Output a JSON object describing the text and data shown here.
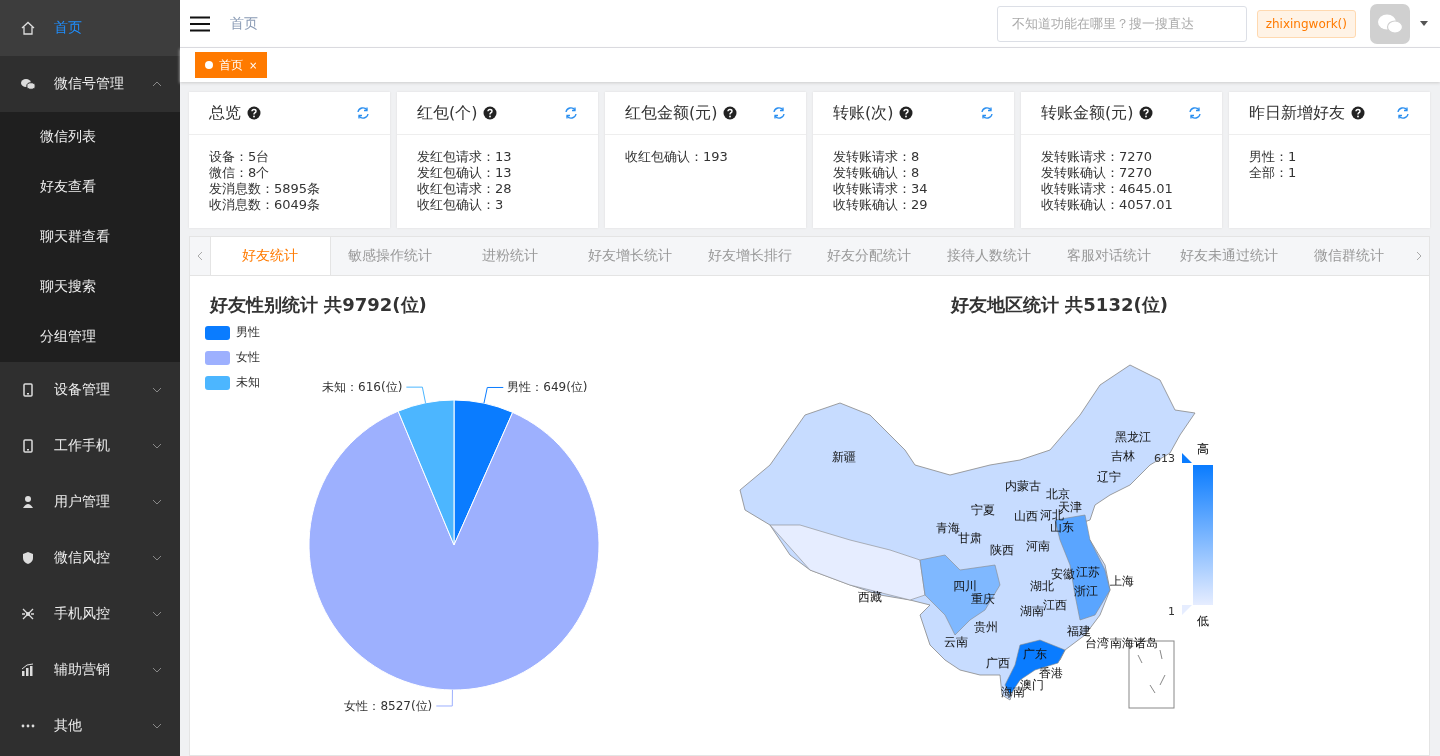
{
  "sidebar": {
    "items": [
      {
        "label": "首页",
        "selected": true,
        "expanded": false
      },
      {
        "label": "微信号管理",
        "selected": false,
        "expanded": true,
        "children": [
          {
            "label": "微信列表",
            "selected": false
          },
          {
            "label": "好友查看",
            "selected": false
          },
          {
            "label": "聊天群查看",
            "selected": false
          },
          {
            "label": "聊天搜索",
            "selected": false
          },
          {
            "label": "分组管理",
            "selected": false
          }
        ]
      },
      {
        "label": "设备管理",
        "selected": false,
        "expanded": false
      },
      {
        "label": "工作手机",
        "selected": false,
        "expanded": false
      },
      {
        "label": "用户管理",
        "selected": false,
        "expanded": false
      },
      {
        "label": "微信风控",
        "selected": false,
        "expanded": false
      },
      {
        "label": "手机风控",
        "selected": false,
        "expanded": false
      },
      {
        "label": "辅助营销",
        "selected": false,
        "expanded": false
      },
      {
        "label": "其他",
        "selected": false,
        "expanded": false
      }
    ]
  },
  "header": {
    "breadcrumb": "首页",
    "search": {
      "placeholder": "不知道功能在哪里？搜一搜直达"
    },
    "user": "zhixingwork()"
  },
  "tag_bar": [
    {
      "label": "首页",
      "close": "×",
      "selected": true
    }
  ],
  "cards": [
    {
      "title": "总览",
      "lines": [
        "设备：5台",
        "微信：8个",
        "发消息数：5895条",
        "收消息数：6049条"
      ]
    },
    {
      "title": "红包(个)",
      "lines": [
        "发红包请求：13",
        "发红包确认：13",
        "收红包请求：28",
        "收红包确认：3"
      ]
    },
    {
      "title": "红包金额(元)",
      "lines": [
        "收红包确认：193"
      ]
    },
    {
      "title": "转账(次)",
      "lines": [
        "发转账请求：8",
        "发转账确认：8",
        "收转账请求：34",
        "收转账确认：29"
      ]
    },
    {
      "title": "转账金额(元)",
      "lines": [
        "发转账请求：7270",
        "发转账确认：7270",
        "收转账请求：4645.01",
        "收转账确认：4057.01"
      ]
    },
    {
      "title": "昨日新增好友",
      "lines": [
        "男性：1",
        "全部：1"
      ]
    }
  ],
  "tabs": [
    {
      "label": "好友统计",
      "selected": true
    },
    {
      "label": "敏感操作统计",
      "selected": false
    },
    {
      "label": "进粉统计",
      "selected": false
    },
    {
      "label": "好友增长统计",
      "selected": false
    },
    {
      "label": "好友增长排行",
      "selected": false
    },
    {
      "label": "好友分配统计",
      "selected": false
    },
    {
      "label": "接待人数统计",
      "selected": false
    },
    {
      "label": "客服对话统计",
      "selected": false
    },
    {
      "label": "好友未通过统计",
      "selected": false
    },
    {
      "label": "微信群统计",
      "selected": false
    }
  ],
  "gender_chart": {
    "chart_data": {
      "type": "pie",
      "title": "好友性别统计 共9792(位)",
      "categories": [
        "男性",
        "女性",
        "未知"
      ],
      "values": [
        649,
        8527,
        616
      ],
      "colors": [
        "#0a7cff",
        "#9db0fe",
        "#4cb6ff"
      ],
      "value_labels": [
        "男性：649(位)",
        "女性：8527(位)",
        "未知：616(位)"
      ]
    }
  },
  "region_chart": {
    "title": "好友地区统计 共5132(位)",
    "labels": [
      "新疆",
      "西藏",
      "青海",
      "甘肃",
      "宁夏",
      "内蒙古",
      "黑龙江",
      "吉林",
      "辽宁",
      "北京",
      "天津",
      "山西",
      "河北",
      "山东",
      "河南",
      "陕西",
      "四川",
      "重庆",
      "湖北",
      "安徽",
      "江苏",
      "上海",
      "浙江",
      "湖南",
      "江西",
      "贵州",
      "云南",
      "广西",
      "广东",
      "福建",
      "台湾",
      "南海诸岛",
      "澳门",
      "香港",
      "海南"
    ],
    "scale": {
      "high_label": "高",
      "max": "613",
      "min": "1",
      "low_label": "低"
    }
  }
}
